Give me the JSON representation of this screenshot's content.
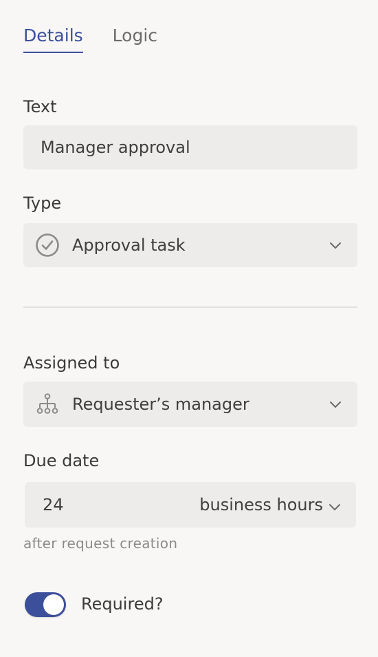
{
  "tabs": [
    {
      "label": "Details",
      "active": true
    },
    {
      "label": "Logic",
      "active": false
    }
  ],
  "text_field": {
    "label": "Text",
    "value": "Manager approval"
  },
  "type_field": {
    "label": "Type",
    "value": "Approval task",
    "icon": "check-circle-icon"
  },
  "assigned_field": {
    "label": "Assigned to",
    "value": "Requester’s manager",
    "icon": "org-chart-icon"
  },
  "due_date": {
    "label": "Due date",
    "amount": "24",
    "unit": "business hours",
    "hint": "after request creation"
  },
  "required": {
    "label": "Required?",
    "checked": true
  },
  "colors": {
    "accent": "#3c4f9b",
    "background": "#f8f7f5",
    "field_bg": "#edecea"
  }
}
